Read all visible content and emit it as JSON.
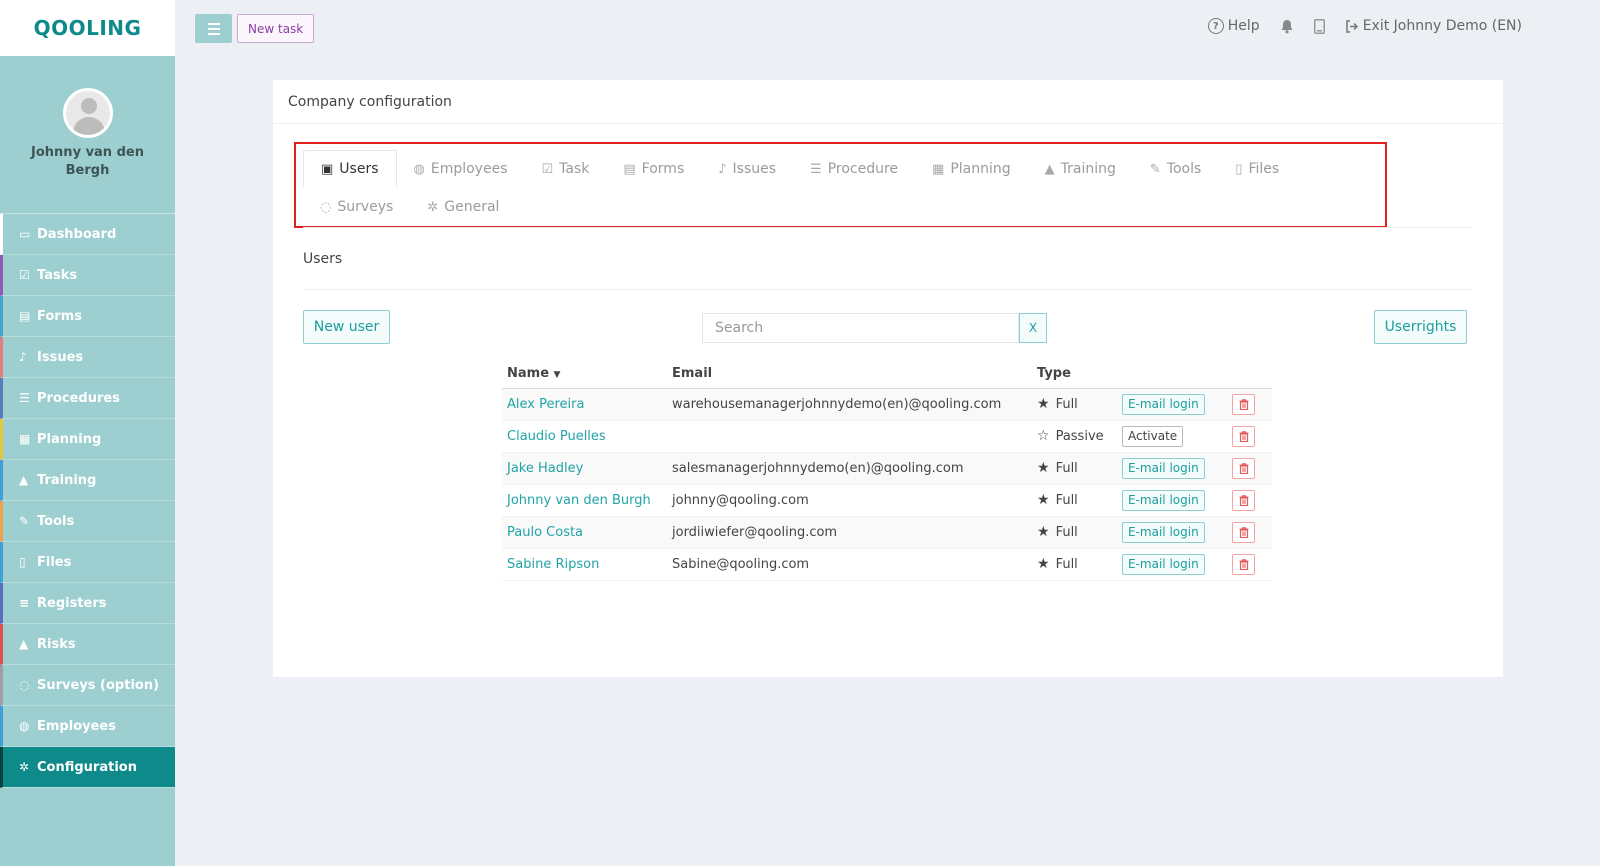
{
  "app": {
    "logo": "QOOLING"
  },
  "sidebar": {
    "profile_name": "Johnny van den Bergh",
    "items": [
      {
        "label": "Dashboard",
        "icon": "monitor-icon",
        "glyph": "▭",
        "color": "#ffffff"
      },
      {
        "label": "Tasks",
        "icon": "checkbox-icon",
        "glyph": "☑",
        "color": "#8e5bb5"
      },
      {
        "label": "Forms",
        "icon": "document-icon",
        "glyph": "▤",
        "color": "#43a8c5"
      },
      {
        "label": "Issues",
        "icon": "bell-icon",
        "glyph": "♪",
        "color": "#e37c7c"
      },
      {
        "label": "Procedures",
        "icon": "list-icon",
        "glyph": "☰",
        "color": "#5b7bbf"
      },
      {
        "label": "Planning",
        "icon": "calendar-icon",
        "glyph": "▦",
        "color": "#e0c83a"
      },
      {
        "label": "Training",
        "icon": "graduation-cap-icon",
        "glyph": "▲",
        "color": "#3fa0d8"
      },
      {
        "label": "Tools",
        "icon": "wrench-icon",
        "glyph": "✎",
        "color": "#e8a34b"
      },
      {
        "label": "Files",
        "icon": "file-icon",
        "glyph": "▯",
        "color": "#3fa0d8"
      },
      {
        "label": "Registers",
        "icon": "register-icon",
        "glyph": "≡",
        "color": "#5b6bbf"
      },
      {
        "label": "Risks",
        "icon": "warning-icon",
        "glyph": "▲",
        "color": "#e05050"
      },
      {
        "label": "Surveys (option)",
        "icon": "chat-icon",
        "glyph": "◌",
        "color": "#9aa0a6"
      },
      {
        "label": "Employees",
        "icon": "users-icon",
        "glyph": "◍",
        "color": "#3fa0d8"
      },
      {
        "label": "Configuration",
        "icon": "gear-icon",
        "glyph": "✲",
        "color": "#083f3f"
      }
    ]
  },
  "topbar": {
    "new_task": "New task",
    "help": "Help",
    "exit": "Exit Johnny Demo (EN)"
  },
  "panel": {
    "title": "Company configuration",
    "tabs": [
      {
        "label": "Users",
        "icon": "id-card-icon",
        "glyph": "▣"
      },
      {
        "label": "Employees",
        "icon": "users-icon",
        "glyph": "◍"
      },
      {
        "label": "Task",
        "icon": "checkbox-icon",
        "glyph": "☑"
      },
      {
        "label": "Forms",
        "icon": "document-icon",
        "glyph": "▤"
      },
      {
        "label": "Issues",
        "icon": "bell-icon",
        "glyph": "♪"
      },
      {
        "label": "Procedure",
        "icon": "list-icon",
        "glyph": "☰"
      },
      {
        "label": "Planning",
        "icon": "calendar-icon",
        "glyph": "▦"
      },
      {
        "label": "Training",
        "icon": "graduation-cap-icon",
        "glyph": "▲"
      },
      {
        "label": "Tools",
        "icon": "wrench-icon",
        "glyph": "✎"
      },
      {
        "label": "Files",
        "icon": "file-icon",
        "glyph": "▯"
      },
      {
        "label": "Surveys",
        "icon": "chat-icon",
        "glyph": "◌"
      },
      {
        "label": "General",
        "icon": "gear-icon",
        "glyph": "✲"
      }
    ],
    "section_title": "Users",
    "new_user": "New user",
    "search_placeholder": "Search",
    "search_clear": "X",
    "userrights": "Userrights",
    "columns": {
      "name": "Name",
      "email": "Email",
      "type": "Type"
    },
    "users": [
      {
        "name": "Alex Pereira",
        "email": "warehousemanagerjohnnydemo(en)@qooling.com",
        "type": "Full",
        "action": "E-mail login"
      },
      {
        "name": "Claudio Puelles",
        "email": "",
        "type": "Passive",
        "action": "Activate"
      },
      {
        "name": "Jake Hadley",
        "email": "salesmanagerjohnnydemo(en)@qooling.com",
        "type": "Full",
        "action": "E-mail login"
      },
      {
        "name": "Johnny van den Burgh",
        "email": "johnny@qooling.com",
        "type": "Full",
        "action": "E-mail login"
      },
      {
        "name": "Paulo Costa",
        "email": "jordiiwiefer@qooling.com",
        "type": "Full",
        "action": "E-mail login"
      },
      {
        "name": "Sabine Ripson",
        "email": "Sabine@qooling.com",
        "type": "Full",
        "action": "E-mail login"
      }
    ]
  }
}
